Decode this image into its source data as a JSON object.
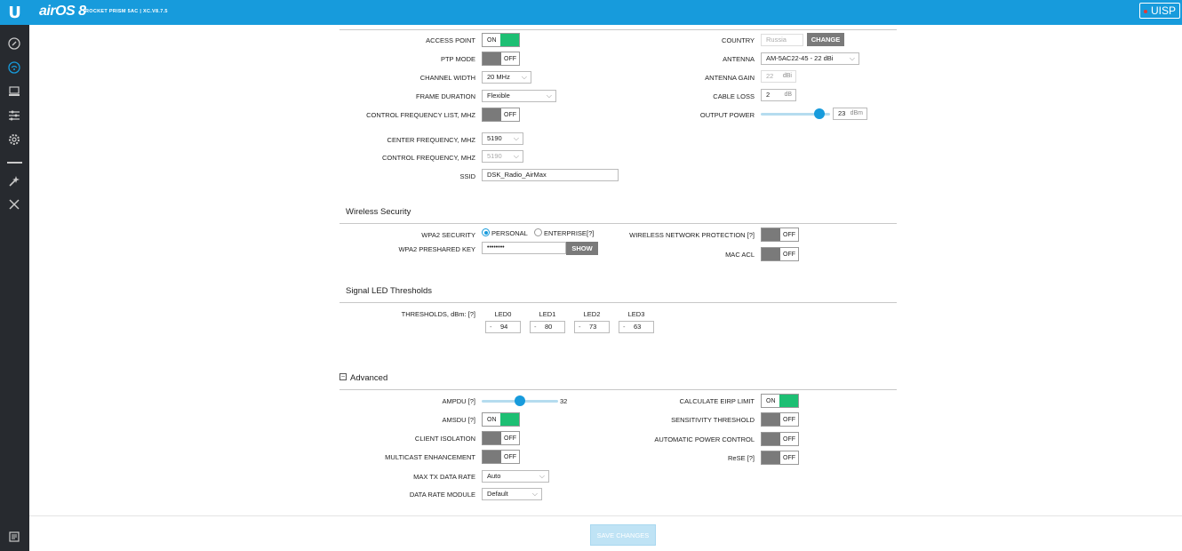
{
  "topbar": {
    "logo": "U",
    "brand": "airOS 8",
    "device": "ROCKET PRISM 5AC | XC.V8.7.5",
    "uisp": "UISP"
  },
  "sidebar": {
    "icons": [
      "dashboard-icon",
      "wireless-icon",
      "network-icon",
      "services-icon",
      "settings-icon",
      "tools-icon",
      "utilities-icon",
      "log-icon"
    ]
  },
  "wireless": {
    "access_point": {
      "label": "ACCESS POINT",
      "state": "ON"
    },
    "ptp_mode": {
      "label": "PTP MODE",
      "state": "OFF"
    },
    "channel_width": {
      "label": "CHANNEL WIDTH",
      "value": "20 MHz"
    },
    "frame_duration": {
      "label": "FRAME DURATION",
      "value": "Flexible"
    },
    "control_freq_list": {
      "label": "CONTROL FREQUENCY LIST, MHz",
      "state": "OFF"
    },
    "center_freq": {
      "label": "CENTER FREQUENCY, MHz",
      "value": "5190"
    },
    "control_freq": {
      "label": "CONTROL FREQUENCY, MHz",
      "value": "5190"
    },
    "ssid": {
      "label": "SSID",
      "value": "DSK_Radio_AirMax"
    },
    "country": {
      "label": "COUNTRY",
      "value": "Russia",
      "button": "CHANGE"
    },
    "antenna": {
      "label": "ANTENNA",
      "value": "AM-5AC22-45 - 22 dBi"
    },
    "antenna_gain": {
      "label": "ANTENNA GAIN",
      "value": "22",
      "unit": "dBi"
    },
    "cable_loss": {
      "label": "CABLE LOSS",
      "value": "2",
      "unit": "dB"
    },
    "output_power": {
      "label": "OUTPUT POWER",
      "value": "23",
      "unit": "dBm",
      "level": 0.85
    }
  },
  "security": {
    "title": "Wireless Security",
    "wpa2_label": "WPA2 SECURITY",
    "personal": "PERSONAL",
    "enterprise": "ENTERPRISE",
    "enterprise_help": "[?]",
    "psk_label": "WPA2 PRESHARED KEY",
    "psk_value": "••••••••",
    "show": "SHOW",
    "wnp": {
      "label": "WIRELESS NETWORK PROTECTION [?]",
      "state": "OFF"
    },
    "mac_acl": {
      "label": "MAC ACL",
      "state": "OFF"
    }
  },
  "led": {
    "title": "Signal LED Thresholds",
    "label": "THRESHOLDS, dBm: [?]",
    "items": [
      {
        "name": "LED0",
        "sign": "-",
        "value": "94"
      },
      {
        "name": "LED1",
        "sign": "-",
        "value": "80"
      },
      {
        "name": "LED2",
        "sign": "-",
        "value": "73"
      },
      {
        "name": "LED3",
        "sign": "-",
        "value": "63"
      }
    ]
  },
  "advanced": {
    "title": "Advanced",
    "collapse_symbol": "−",
    "ampdu": {
      "label": "AMPDU [?]",
      "value": "32",
      "level": 0.5
    },
    "amsdu": {
      "label": "AMSDU [?]",
      "state": "ON"
    },
    "client_isolation": {
      "label": "CLIENT ISOLATION",
      "state": "OFF"
    },
    "multicast": {
      "label": "MULTICAST ENHANCEMENT",
      "state": "OFF"
    },
    "max_tx": {
      "label": "MAX TX DATA RATE",
      "value": "Auto"
    },
    "data_rate_module": {
      "label": "DATA RATE MODULE",
      "value": "Default"
    },
    "eirp": {
      "label": "CALCULATE EIRP LIMIT",
      "state": "ON"
    },
    "sensitivity": {
      "label": "SENSITIVITY THRESHOLD",
      "state": "OFF"
    },
    "apc": {
      "label": "AUTOMATIC POWER CONTROL",
      "state": "OFF"
    },
    "rese": {
      "label": "ReSE [?]",
      "state": "OFF"
    }
  },
  "save_label": "SAVE CHANGES",
  "colors": {
    "accent": "#179bdc",
    "on": "#1dbf73",
    "sidebar": "#272a2f"
  }
}
